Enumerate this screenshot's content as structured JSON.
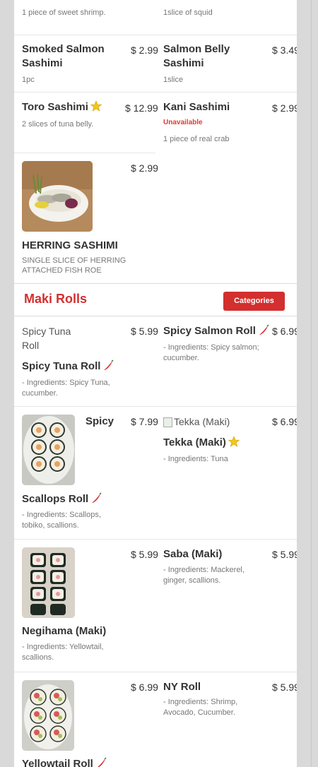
{
  "sashimi": {
    "top_left": {
      "desc": "1 piece of sweet shrimp."
    },
    "top_right": {
      "desc": "1slice of squid"
    },
    "smoked_salmon": {
      "name_line1": "Smoked Salmon",
      "name_line2": "Sashimi",
      "price": "$ 2.99",
      "desc": "1pc"
    },
    "salmon_belly": {
      "name_line1": "Salmon Belly",
      "name_line2": "Sashimi",
      "price": "$ 3.49",
      "desc": "1slice"
    },
    "toro": {
      "name": "Toro Sashimi",
      "price": "$ 12.99",
      "desc": "2 slices of tuna belly."
    },
    "kani": {
      "name": "Kani Sashimi",
      "status": "Unavailable",
      "price": "$ 2.99",
      "desc": "1 piece of real crab"
    },
    "herring": {
      "name": "HERRING SASHIMI",
      "price": "$ 2.99",
      "desc_line1": "SINGLE SLICE OF HERRING",
      "desc_line2": "ATTACHED FISH ROE"
    }
  },
  "section": {
    "title": "Maki Rolls",
    "button": "Categories"
  },
  "maki": {
    "spicy_tuna": {
      "alt_line1": "Spicy Tuna",
      "alt_line2": "Roll",
      "name": "Spicy Tuna Roll",
      "price": "$ 5.99",
      "desc_line1": "- Ingredients: Spicy Tuna,",
      "desc_line2": "cucumber."
    },
    "spicy_salmon": {
      "name": "Spicy Salmon Roll",
      "price": "$ 6.99",
      "desc_line1": "- Ingredients: Spicy salmon;",
      "desc_line2": "cucumber."
    },
    "spicy_scallops": {
      "name_part1": "Spicy",
      "name_part2": "Scallops Roll",
      "price": "$ 7.99",
      "desc_line1": "- Ingredients: Scallops,",
      "desc_line2": "tobiko, scallions."
    },
    "tekka": {
      "alt": "Tekka (Maki)",
      "name": "Tekka (Maki)",
      "price": "$ 6.99",
      "desc": "- Ingredients: Tuna"
    },
    "negihama": {
      "name": "Negihama (Maki)",
      "price": "$ 5.99",
      "desc_line1": "- Ingredients: Yellowtail,",
      "desc_line2": "scallions."
    },
    "saba": {
      "name": "Saba (Maki)",
      "price": "$ 5.99",
      "desc_line1": "- Ingredients: Mackerel,",
      "desc_line2": "ginger, scallions."
    },
    "yellowtail": {
      "name": "Yellowtail Roll",
      "price": "$ 6.99"
    },
    "ny_roll": {
      "name": "NY Roll",
      "price": "$ 5.99",
      "desc_line1": "- Ingredients: Shrimp,",
      "desc_line2": "Avocado, Cucumber."
    }
  },
  "icons": {
    "featured": "star-icon",
    "spicy": "chili-pepper-icon"
  },
  "colors": {
    "accent": "#d32f2f",
    "unavailable": "#e03a2f",
    "star": "#f5c518",
    "pepper": "#d32f2f"
  }
}
